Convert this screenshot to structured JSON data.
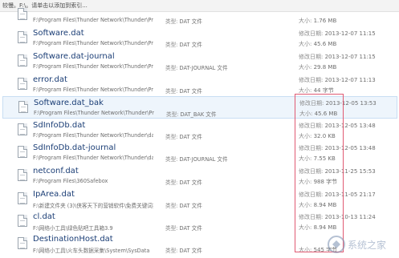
{
  "status_bar": {
    "text": "较慢。F:\\。请单击以添加到索引..."
  },
  "labels": {
    "date": "修改日期:",
    "size": "大小:",
    "type": "类型:"
  },
  "files": [
    {
      "name": "",
      "path": "F:\\Program Files\\Thunder Network\\Thunder\\Pr...",
      "type": "DAT 文件",
      "date": "",
      "size": "1.76 MB"
    },
    {
      "name": "Software.dat",
      "path": "F:\\Program Files\\Thunder Network\\Thunder\\Pr...",
      "type": "DAT 文件",
      "date": "2013-12-07 11:15",
      "size": "45.6 MB"
    },
    {
      "name": "Software.dat-journal",
      "path": "F:\\Program Files\\Thunder Network\\Thunder\\Pr...",
      "type": "DAT-JOURNAL 文件",
      "date": "2013-12-07 11:15",
      "size": "29.8 MB"
    },
    {
      "name": "error.dat",
      "path": "F:\\Program Files\\Thunder Network\\Thunder\\Pr...",
      "type": "DAT 文件",
      "date": "2013-12-07 11:13",
      "size": "44 字节"
    },
    {
      "name": "Software.dat_bak",
      "path": "F:\\Program Files\\Thunder Network\\Thunder\\Pr...",
      "type": "DAT_BAK 文件",
      "date": "2013-12-05 13:53",
      "size": "45.6 MB"
    },
    {
      "name": "SdInfoDb.dat",
      "path": "F:\\Program Files\\Thunder Network\\Thunder\\data",
      "type": "DAT 文件",
      "date": "2013-12-05 13:48",
      "size": "32.0 KB"
    },
    {
      "name": "SdInfoDb.dat-journal",
      "path": "F:\\Program Files\\Thunder Network\\Thunder\\data",
      "type": "DAT-JOURNAL 文件",
      "date": "2013-12-05 13:48",
      "size": "7.55 KB"
    },
    {
      "name": "netconf.dat",
      "path": "F:\\Program Files\\360Safebox",
      "type": "DAT 文件",
      "date": "2013-11-25 15:53",
      "size": "988 字节"
    },
    {
      "name": "IpArea.dat",
      "path": "F:\\新建文件夹 (3)\\侠客天下的营销软件\\免费关键词排...",
      "type": "DAT 文件",
      "date": "2013-11-05 21:17",
      "size": "8.94 MB"
    },
    {
      "name": "cl.dat",
      "path": "F:\\网络小工具\\绿色贴吧工具箱3.9",
      "type": "DAT 文件",
      "date": "2013-10-13 11:24",
      "size": "8.94 MB"
    },
    {
      "name": "DestinationHost.dat",
      "path": "F:\\网络小工具\\火车头数据采集\\System\\SysData",
      "type": "DAT 文件",
      "date": "",
      "size": "545 字节"
    }
  ],
  "watermark": {
    "text": "系统之家"
  }
}
